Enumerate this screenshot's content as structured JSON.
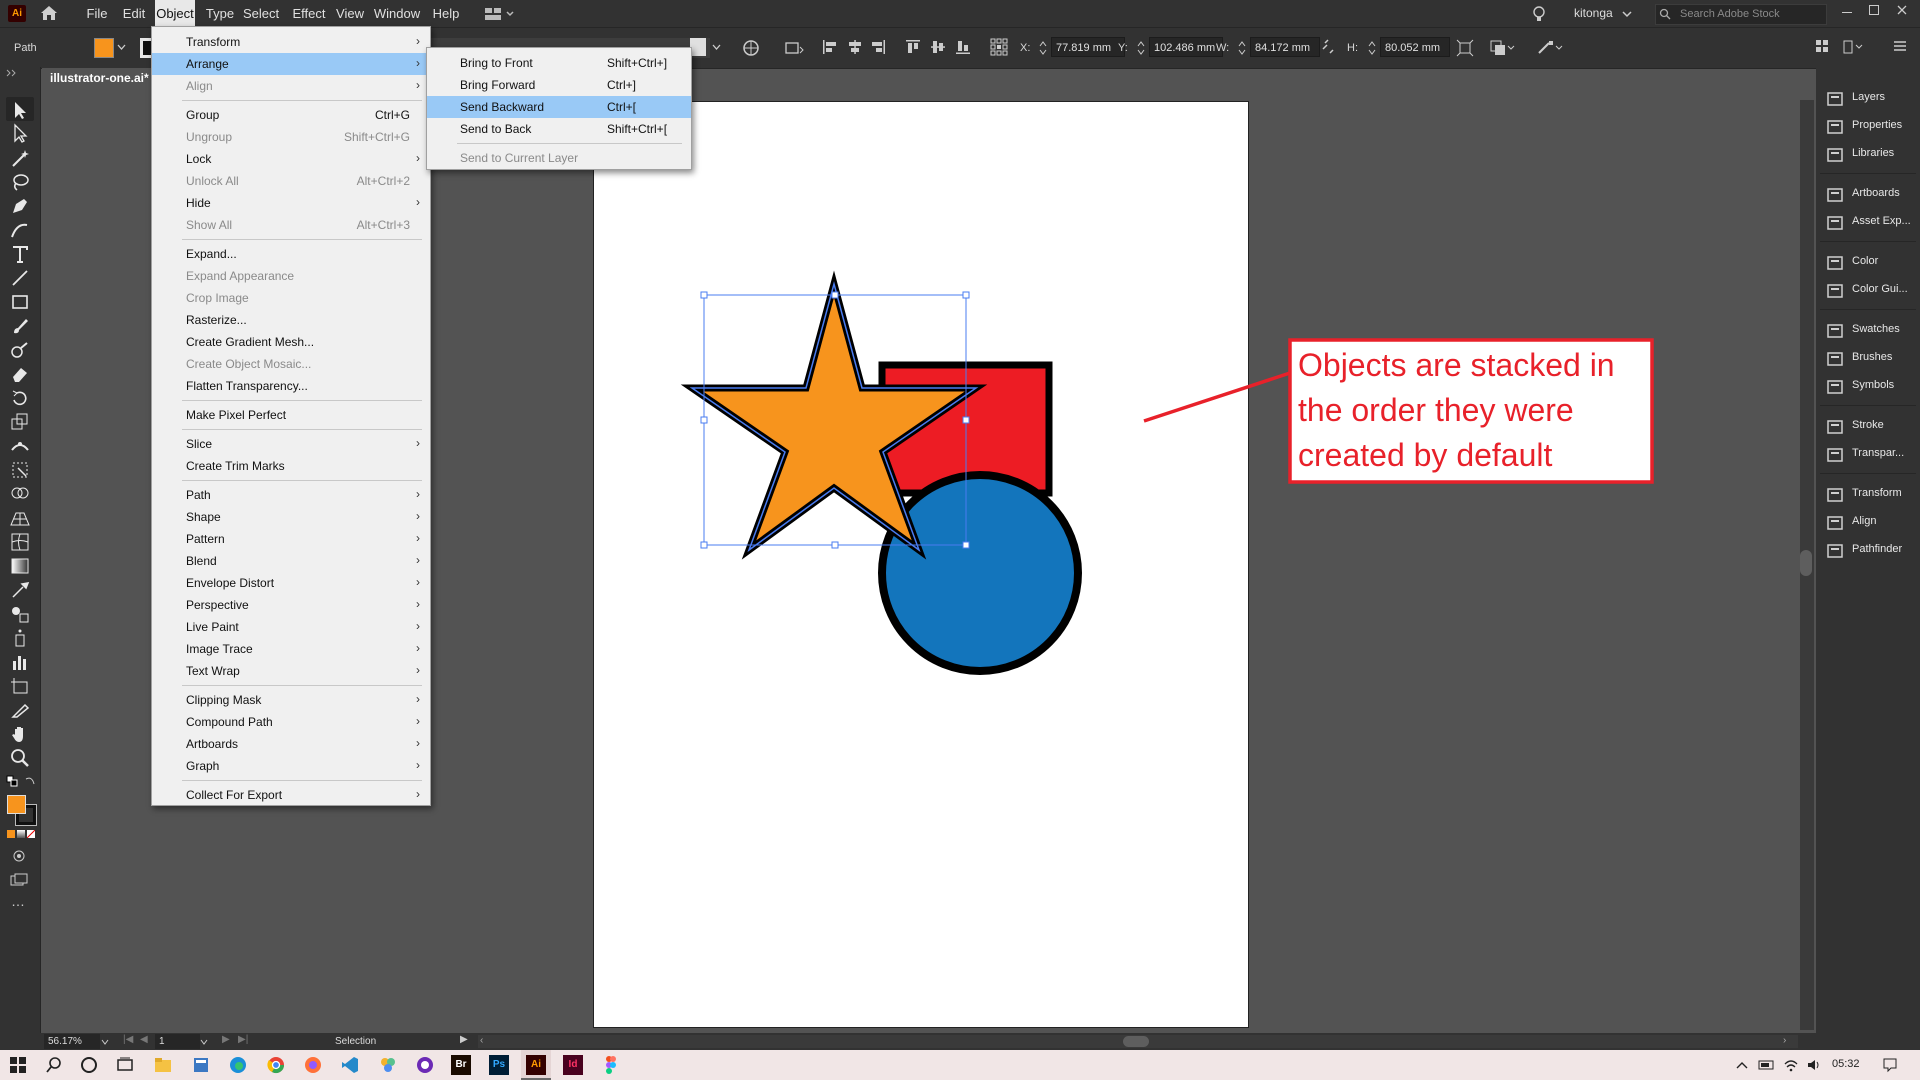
{
  "menubar": {
    "app_logo": "Ai",
    "items": [
      "File",
      "Edit",
      "Object",
      "Type",
      "Select",
      "Effect",
      "View",
      "Window",
      "Help"
    ],
    "user": "kitonga",
    "search_placeholder": "Search Adobe Stock"
  },
  "controlbar": {
    "selection_type": "Path",
    "fill_color": "#f7941d",
    "x_label": "X:",
    "x_value": "77.819 mm",
    "y_label": "Y:",
    "y_value": "102.486 mm",
    "w_label": "W:",
    "w_value": "84.172 mm",
    "h_label": "H:",
    "h_value": "80.052 mm"
  },
  "document_tab": "illustrator-one.ai*",
  "object_menu": {
    "items": [
      {
        "label": "Transform",
        "shortcut": "",
        "submenu": true,
        "disabled": false
      },
      {
        "label": "Arrange",
        "shortcut": "",
        "submenu": true,
        "disabled": false,
        "highlighted": true
      },
      {
        "label": "Align",
        "shortcut": "",
        "submenu": true,
        "disabled": true
      },
      {
        "sep": true
      },
      {
        "label": "Group",
        "shortcut": "Ctrl+G",
        "submenu": false,
        "disabled": false
      },
      {
        "label": "Ungroup",
        "shortcut": "Shift+Ctrl+G",
        "submenu": false,
        "disabled": true
      },
      {
        "label": "Lock",
        "shortcut": "",
        "submenu": true,
        "disabled": false
      },
      {
        "label": "Unlock All",
        "shortcut": "Alt+Ctrl+2",
        "submenu": false,
        "disabled": true
      },
      {
        "label": "Hide",
        "shortcut": "",
        "submenu": true,
        "disabled": false
      },
      {
        "label": "Show All",
        "shortcut": "Alt+Ctrl+3",
        "submenu": false,
        "disabled": true
      },
      {
        "sep": true
      },
      {
        "label": "Expand...",
        "shortcut": "",
        "submenu": false,
        "disabled": false
      },
      {
        "label": "Expand Appearance",
        "shortcut": "",
        "submenu": false,
        "disabled": true
      },
      {
        "label": "Crop Image",
        "shortcut": "",
        "submenu": false,
        "disabled": true
      },
      {
        "label": "Rasterize...",
        "shortcut": "",
        "submenu": false,
        "disabled": false
      },
      {
        "label": "Create Gradient Mesh...",
        "shortcut": "",
        "submenu": false,
        "disabled": false
      },
      {
        "label": "Create Object Mosaic...",
        "shortcut": "",
        "submenu": false,
        "disabled": true
      },
      {
        "label": "Flatten Transparency...",
        "shortcut": "",
        "submenu": false,
        "disabled": false
      },
      {
        "sep": true
      },
      {
        "label": "Make Pixel Perfect",
        "shortcut": "",
        "submenu": false,
        "disabled": false
      },
      {
        "sep": true
      },
      {
        "label": "Slice",
        "shortcut": "",
        "submenu": true,
        "disabled": false
      },
      {
        "label": "Create Trim Marks",
        "shortcut": "",
        "submenu": false,
        "disabled": false
      },
      {
        "sep": true
      },
      {
        "label": "Path",
        "shortcut": "",
        "submenu": true,
        "disabled": false
      },
      {
        "label": "Shape",
        "shortcut": "",
        "submenu": true,
        "disabled": false
      },
      {
        "label": "Pattern",
        "shortcut": "",
        "submenu": true,
        "disabled": false
      },
      {
        "label": "Blend",
        "shortcut": "",
        "submenu": true,
        "disabled": false
      },
      {
        "label": "Envelope Distort",
        "shortcut": "",
        "submenu": true,
        "disabled": false
      },
      {
        "label": "Perspective",
        "shortcut": "",
        "submenu": true,
        "disabled": false
      },
      {
        "label": "Live Paint",
        "shortcut": "",
        "submenu": true,
        "disabled": false
      },
      {
        "label": "Image Trace",
        "shortcut": "",
        "submenu": true,
        "disabled": false
      },
      {
        "label": "Text Wrap",
        "shortcut": "",
        "submenu": true,
        "disabled": false
      },
      {
        "sep": true
      },
      {
        "label": "Clipping Mask",
        "shortcut": "",
        "submenu": true,
        "disabled": false
      },
      {
        "label": "Compound Path",
        "shortcut": "",
        "submenu": true,
        "disabled": false
      },
      {
        "label": "Artboards",
        "shortcut": "",
        "submenu": true,
        "disabled": false
      },
      {
        "label": "Graph",
        "shortcut": "",
        "submenu": true,
        "disabled": false
      },
      {
        "sep": true
      },
      {
        "label": "Collect For Export",
        "shortcut": "",
        "submenu": true,
        "disabled": false
      }
    ]
  },
  "arrange_menu": {
    "items": [
      {
        "label": "Bring to Front",
        "shortcut": "Shift+Ctrl+]",
        "disabled": false
      },
      {
        "label": "Bring Forward",
        "shortcut": "Ctrl+]",
        "disabled": false
      },
      {
        "label": "Send Backward",
        "shortcut": "Ctrl+[",
        "disabled": false,
        "highlighted": true
      },
      {
        "label": "Send to Back",
        "shortcut": "Shift+Ctrl+[",
        "disabled": false
      },
      {
        "sep": true
      },
      {
        "label": "Send to Current Layer",
        "shortcut": "",
        "disabled": true
      }
    ]
  },
  "annotation": {
    "text": "Objects are stacked in the order they were created by default",
    "color": "#e8212a"
  },
  "right_panel": {
    "items": [
      "Layers",
      "Properties",
      "Libraries",
      "Artboards",
      "Asset Exp...",
      "Color",
      "Color Gui...",
      "Swatches",
      "Brushes",
      "Symbols",
      "Stroke",
      "Transpar...",
      "Transform",
      "Align",
      "Pathfinder"
    ]
  },
  "statusbar": {
    "zoom": "56.17%",
    "artboard_num": "1",
    "tool": "Selection"
  },
  "taskbar": {
    "time": "05:32"
  },
  "colors": {
    "star": "#f7941d",
    "rectangle": "#ed1c24",
    "circle": "#1375bc",
    "selection": "#4a7cf0"
  }
}
